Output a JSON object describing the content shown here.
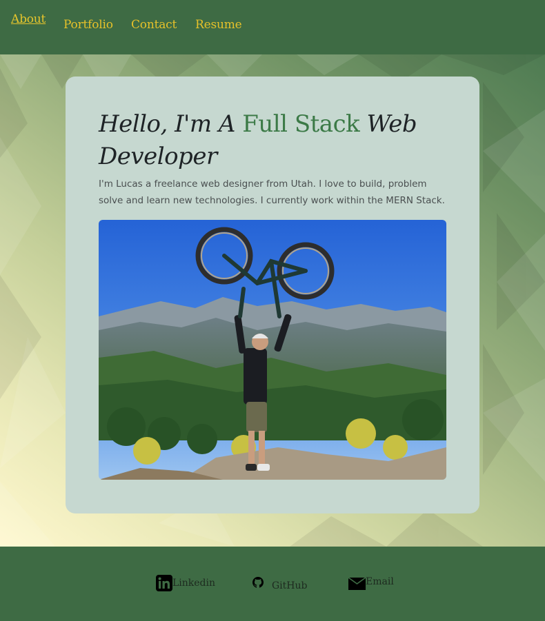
{
  "nav": {
    "items": [
      {
        "label": "About",
        "active": true
      },
      {
        "label": "Portfolio",
        "active": false
      },
      {
        "label": "Contact",
        "active": false
      },
      {
        "label": "Resume",
        "active": false
      }
    ]
  },
  "hero": {
    "headline_prefix": "Hello, I'm A",
    "headline_accent": "Full Stack",
    "headline_suffix": "Web Developer",
    "intro": "I'm Lucas a freelance web designer from Utah. I love to build, problem solve and learn new technologies. I currently work within the MERN Stack.",
    "photo_alt": "Person holding a mountain bike overhead on a mountain summit"
  },
  "footer": {
    "links": [
      {
        "label": "Linkedin",
        "icon": "linkedin-icon"
      },
      {
        "label": "GitHub",
        "icon": "github-icon"
      },
      {
        "label": "Email",
        "icon": "envelope-icon"
      }
    ]
  },
  "colors": {
    "nav_bg": "#3e6b44",
    "nav_link": "#e6c12a",
    "card_bg": "#c6d8d0",
    "accent": "#3c7a47"
  }
}
